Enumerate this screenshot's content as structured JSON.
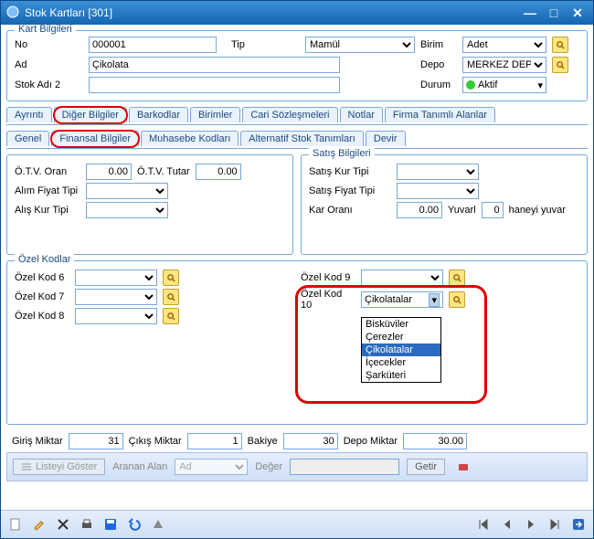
{
  "window": {
    "title": "Stok Kartları  [301]"
  },
  "kart": {
    "legend": "Kart Bilgileri",
    "no_label": "No",
    "no": "000001",
    "ad_label": "Ad",
    "ad": "Çikolata",
    "stok2_label": "Stok Adı 2",
    "stok2": "",
    "tip_label": "Tip",
    "tip": "Mamül",
    "birim_label": "Birim",
    "birim": "Adet",
    "depo_label": "Depo",
    "depo": "MERKEZ DEPO",
    "durum_label": "Durum",
    "durum": "Aktif"
  },
  "tabs1": [
    "Ayrıntı",
    "Diğer Bilgiler",
    "Barkodlar",
    "Birimler",
    "Cari Sözleşmeleri",
    "Notlar",
    "Firma Tanımlı Alanlar"
  ],
  "tabs2": [
    "Genel",
    "Finansal Bilgiler",
    "Muhasebe Kodları",
    "Alternatif Stok Tanımları",
    "Devir"
  ],
  "col_left": {
    "otv_oran_label": "Ö.T.V. Oran",
    "otv_oran": "0.00",
    "otv_tutar_label": "Ö.T.V. Tutar",
    "otv_tutar": "0.00",
    "alim_label": "Alım Fiyat Tipi",
    "alis_label": "Alış Kur Tipi"
  },
  "satis": {
    "legend": "Satış Bilgileri",
    "kur_label": "Satış Kur Tipi",
    "fiyat_label": "Satış Fiyat Tipi",
    "kar_label": "Kar Oranı",
    "kar": "0.00",
    "yuvarl_label": "Yuvarl",
    "yuvarl": "0",
    "haneyi": "haneyi yuvar"
  },
  "ozel": {
    "legend": "Özel Kodlar",
    "k6": "Özel Kod 6",
    "k7": "Özel Kod 7",
    "k8": "Özel Kod 8",
    "k9": "Özel Kod 9",
    "k10": "Özel Kod 10",
    "k10_val": "Çikolatalar",
    "options": [
      "Bisküviler",
      "Çerezler",
      "Çikolatalar",
      "İçecekler",
      "Şarküteri"
    ]
  },
  "bottom": {
    "giris_label": "Giriş Miktar",
    "giris": "31",
    "cikis_label": "Çıkış Miktar",
    "cikis": "1",
    "bakiye_label": "Bakiye",
    "bakiye": "30",
    "depo_label": "Depo Miktar",
    "depo": "30.00"
  },
  "filter": {
    "liste": "Listeyi Göster",
    "aranan": "Aranan Alan",
    "ad": "Ad",
    "deger": "Değer",
    "getir": "Getir"
  }
}
